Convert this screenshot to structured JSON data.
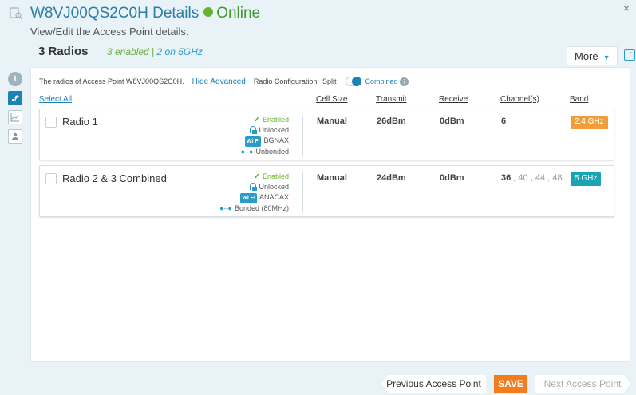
{
  "header": {
    "title": "W8VJ00QS2C0H Details",
    "status": "Online",
    "subtitle": "View/Edit the Access Point details.",
    "close": "×"
  },
  "section": {
    "title": "3 Radios",
    "enabled_text": "3 enabled |",
    "on5_text": "2 on 5GHz",
    "more_label": "More"
  },
  "info": {
    "prefix": "The radios of Access Point W8VJ00QS2C0H.",
    "hide_advanced": "Hide Advanced",
    "radio_config_label": "Radio Configuration:",
    "split_label": "Split",
    "combined_label": "Combined"
  },
  "columns": {
    "select_all": "Select All",
    "cell_size": "Cell Size",
    "transmit": "Transmit",
    "receive": "Receive",
    "channels": "Channel(s)",
    "band": "Band"
  },
  "radios": [
    {
      "name": "Radio 1",
      "enabled": "Enabled",
      "lock": "Unlocked",
      "mode": "BGNAX",
      "bond": "Unbonded",
      "cell_size": "Manual",
      "transmit": "26dBm",
      "receive": "0dBm",
      "channel_primary": "6",
      "channel_rest": "",
      "band": "2.4 GHz",
      "band_color": "#ef9e3a"
    },
    {
      "name": "Radio 2 & 3 Combined",
      "enabled": "Enabled",
      "lock": "Unlocked",
      "mode": "ANACAX",
      "bond": "Bonded (80MHz)",
      "cell_size": "Manual",
      "transmit": "24dBm",
      "receive": "0dBm",
      "channel_primary": "36",
      "channel_rest": " , 40 , 44 , 48",
      "band": "5 GHz",
      "band_color": "#1aa3b3"
    }
  ],
  "footer": {
    "prev": "Previous Access Point",
    "save": "SAVE",
    "next": "Next Access Point"
  },
  "icons": {
    "wifi_text": "Wi Fi"
  }
}
